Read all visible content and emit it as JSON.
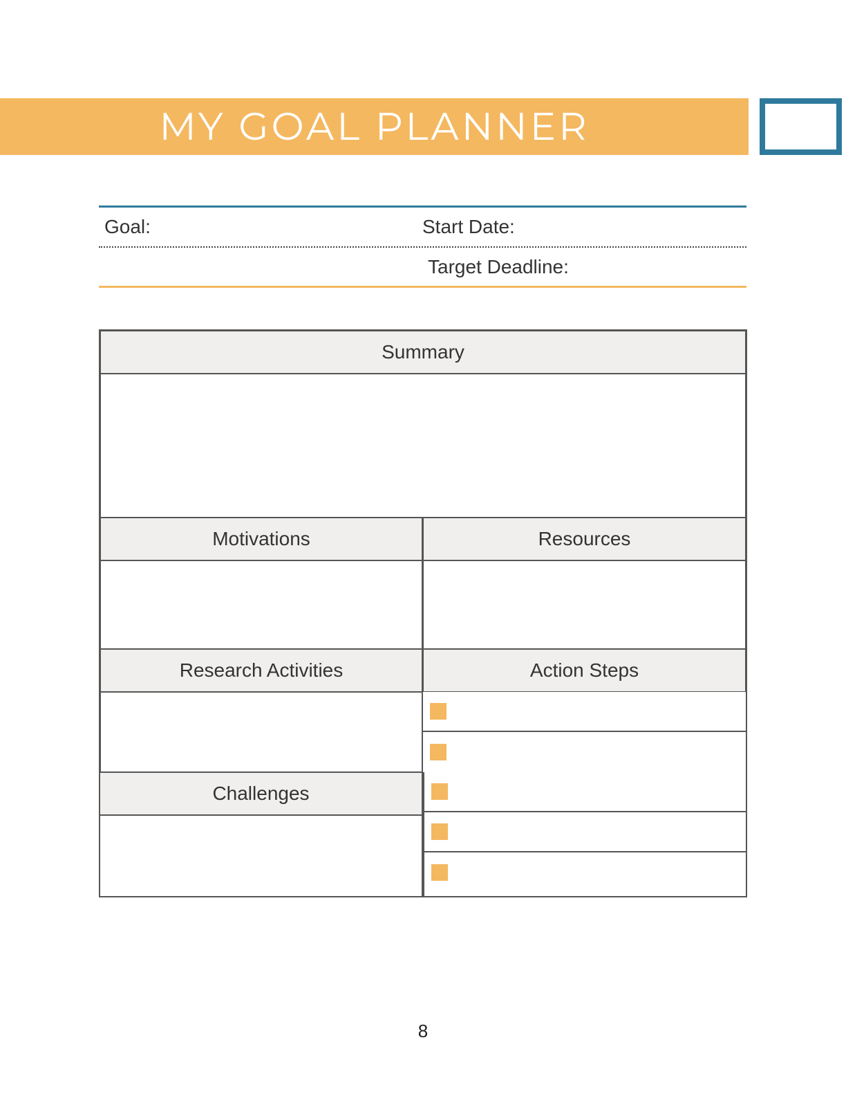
{
  "header": {
    "title": "MY GOAL PLANNER"
  },
  "info": {
    "goal_label": "Goal:",
    "start_date_label": "Start Date:",
    "target_deadline_label": "Target Deadline:"
  },
  "sections": {
    "summary": "Summary",
    "motivations": "Motivations",
    "resources": "Resources",
    "research_activities": "Research Activities",
    "action_steps": "Action Steps",
    "challenges": "Challenges"
  },
  "page_number": "8"
}
